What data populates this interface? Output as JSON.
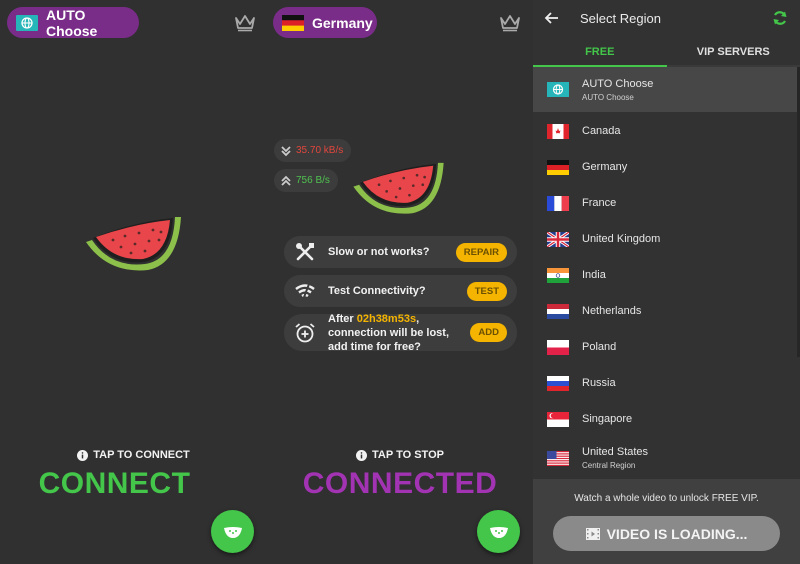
{
  "screen1": {
    "server_pill": {
      "label": "AUTO Choose",
      "icon": "globe-icon"
    },
    "crown_icon": "crown-icon",
    "tap_hint": "TAP TO CONNECT",
    "status": "CONNECT",
    "fab_icon": "watermelon-icon"
  },
  "screen2": {
    "server_pill": {
      "label": "Germany",
      "icon": "germany-flag-icon"
    },
    "crown_icon": "crown-icon",
    "download_speed": "35.70 kB/s",
    "upload_speed": "756 B/s",
    "cards": [
      {
        "text": "Slow or not works?",
        "button": "REPAIR",
        "icon": "tools-icon"
      },
      {
        "text": "Test Connectivity?",
        "button": "TEST",
        "icon": "wifi-icon"
      },
      {
        "text_before": "After ",
        "time": "02h38m53s",
        "text_after": ", connection will be lost, add time for free?",
        "button": "ADD",
        "icon": "alarm-add-icon"
      }
    ],
    "tap_hint": "TAP TO STOP",
    "status": "CONNECTED",
    "fab_icon": "watermelon-icon"
  },
  "screen3": {
    "title": "Select Region",
    "tabs": [
      {
        "label": "FREE",
        "active": true
      },
      {
        "label": "VIP SERVERS",
        "active": false
      }
    ],
    "regions": [
      {
        "name": "AUTO Choose",
        "sub": "AUTO Choose",
        "flag": "auto",
        "selected": true
      },
      {
        "name": "Canada",
        "flag": "ca"
      },
      {
        "name": "Germany",
        "flag": "de"
      },
      {
        "name": "France",
        "flag": "fr"
      },
      {
        "name": "United Kingdom",
        "flag": "gb"
      },
      {
        "name": "India",
        "flag": "in"
      },
      {
        "name": "Netherlands",
        "flag": "nl"
      },
      {
        "name": "Poland",
        "flag": "pl"
      },
      {
        "name": "Russia",
        "flag": "ru"
      },
      {
        "name": "Singapore",
        "flag": "sg"
      },
      {
        "name": "United States",
        "sub": "Central Region",
        "flag": "us"
      }
    ],
    "footer_message": "Watch a whole video to unlock FREE VIP.",
    "video_button": "VIDEO IS LOADING..."
  },
  "colors": {
    "purple": "#7a2c89",
    "green": "#43c64a",
    "connected_purple": "#a233b2",
    "amber": "#f4b400",
    "download_red": "#e2463c",
    "teal": "#26b5b8"
  }
}
